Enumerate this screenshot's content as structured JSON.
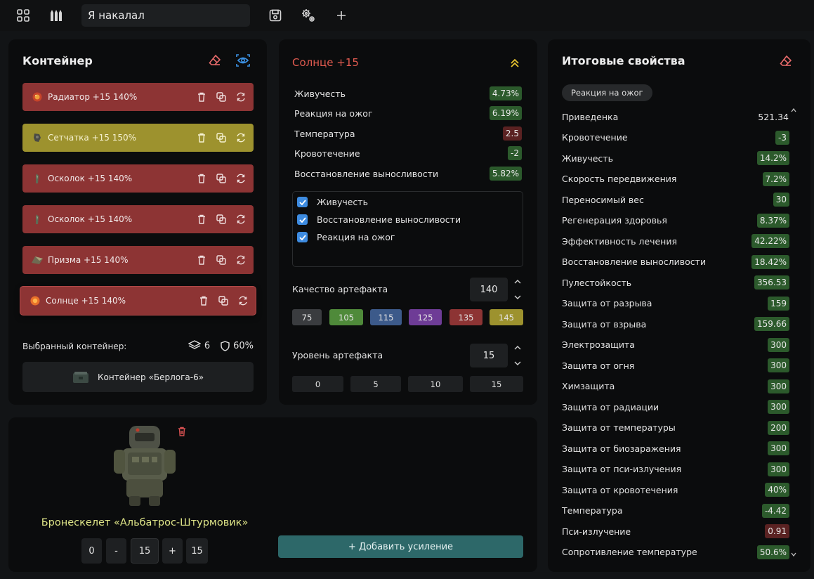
{
  "toolbar": {
    "build_name": "Я накалал",
    "icons": [
      "grid-icon",
      "ammo-icon",
      "save-icon",
      "settings-icon",
      "plus-icon"
    ]
  },
  "container_panel": {
    "title": "Контейнер",
    "items": [
      {
        "label": "Радиатор +15 140%",
        "color": "red",
        "icon": "radiator-artifact-icon"
      },
      {
        "label": "Сетчатка +15 150%",
        "color": "gold",
        "icon": "retina-artifact-icon"
      },
      {
        "label": "Осколок +15 140%",
        "color": "red",
        "icon": "shard-artifact-icon"
      },
      {
        "label": "Осколок +15 140%",
        "color": "red",
        "icon": "shard-artifact-icon"
      },
      {
        "label": "Призма +15 140%",
        "color": "red",
        "icon": "prism-artifact-icon"
      },
      {
        "label": "Солнце +15 140%",
        "color": "red",
        "icon": "sun-artifact-icon",
        "selected": true
      }
    ],
    "selected_label": "Выбранный контейнер:",
    "slots": "6",
    "protection": "60%",
    "container_name": "Контейнер «Берлога-6»"
  },
  "artifact_panel": {
    "title": "Солнце +15",
    "properties": [
      {
        "name": "Живучесть",
        "value": "4.73%",
        "tone": "green"
      },
      {
        "name": "Реакция на ожог",
        "value": "6.19%",
        "tone": "green"
      },
      {
        "name": "Температура",
        "value": "2.5",
        "tone": "red"
      },
      {
        "name": "Кровотечение",
        "value": "-2",
        "tone": "green"
      },
      {
        "name": "Восстановление выносливости",
        "value": "5.82%",
        "tone": "green"
      }
    ],
    "checked": [
      "Живучесть",
      "Восстановление выносливости",
      "Реакция на ожог"
    ],
    "quality_label": "Качество артефакта",
    "quality_value": "140",
    "quality_presets": [
      {
        "label": "75",
        "color": "#3a3c3f"
      },
      {
        "label": "105",
        "color": "#4f8a3a"
      },
      {
        "label": "115",
        "color": "#3c5a8a"
      },
      {
        "label": "125",
        "color": "#6e3c96"
      },
      {
        "label": "135",
        "color": "#8d3434"
      },
      {
        "label": "145",
        "color": "#9d922e"
      }
    ],
    "level_label": "Уровень артефакта",
    "level_value": "15",
    "level_presets": [
      "0",
      "5",
      "10",
      "15"
    ]
  },
  "exoskeleton": {
    "name": "Бронескелет «Альбатрос-Штурмовик»",
    "min": "0",
    "minus": "-",
    "value": "15",
    "plus": "+",
    "max": "15",
    "add_button": "+ Добавить усиление"
  },
  "totals_panel": {
    "title": "Итоговые свойства",
    "filter_chip": "Реакция на ожог",
    "rows": [
      {
        "name": "Приведенка",
        "value": "521.34",
        "tone": "plain"
      },
      {
        "name": "Кровотечение",
        "value": "-3",
        "tone": "green"
      },
      {
        "name": "Живучесть",
        "value": "14.2%",
        "tone": "green"
      },
      {
        "name": "Скорость передвижения",
        "value": "7.2%",
        "tone": "green"
      },
      {
        "name": "Переносимый вес",
        "value": "30",
        "tone": "green"
      },
      {
        "name": "Регенерация здоровья",
        "value": "8.37%",
        "tone": "green"
      },
      {
        "name": "Эффективность лечения",
        "value": "42.22%",
        "tone": "green"
      },
      {
        "name": "Восстановление выносливости",
        "value": "18.42%",
        "tone": "green"
      },
      {
        "name": "Пулестойкость",
        "value": "356.53",
        "tone": "green"
      },
      {
        "name": "Защита от разрыва",
        "value": "159",
        "tone": "green"
      },
      {
        "name": "Защита от взрыва",
        "value": "159.66",
        "tone": "green"
      },
      {
        "name": "Электрозащита",
        "value": "300",
        "tone": "green"
      },
      {
        "name": "Защита от огня",
        "value": "300",
        "tone": "green"
      },
      {
        "name": "Химзащита",
        "value": "300",
        "tone": "green"
      },
      {
        "name": "Защита от радиации",
        "value": "300",
        "tone": "green"
      },
      {
        "name": "Защита от температуры",
        "value": "200",
        "tone": "green"
      },
      {
        "name": "Защита от биозаражения",
        "value": "300",
        "tone": "green"
      },
      {
        "name": "Защита от пси-излучения",
        "value": "300",
        "tone": "green"
      },
      {
        "name": "Защита от кровотечения",
        "value": "40%",
        "tone": "green"
      },
      {
        "name": "Температура",
        "value": "-4.42",
        "tone": "green"
      },
      {
        "name": "Пси-излучение",
        "value": "0.91",
        "tone": "red"
      },
      {
        "name": "Сопротивление температуре",
        "value": "50.6%",
        "tone": "green"
      }
    ]
  }
}
